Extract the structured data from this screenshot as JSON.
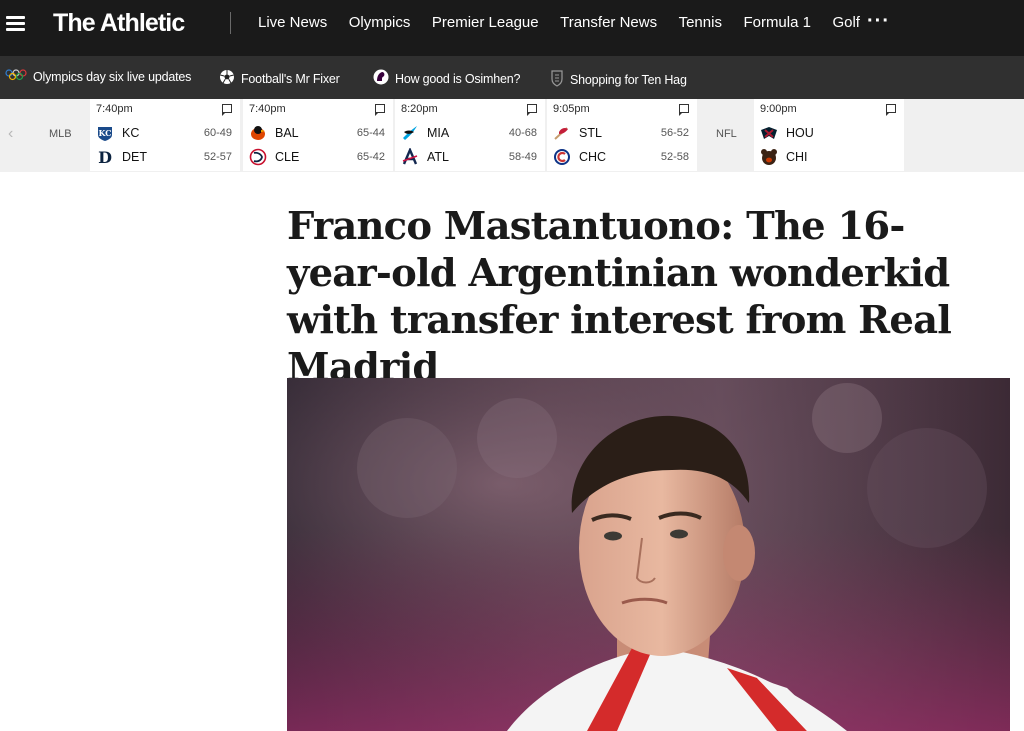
{
  "nav": {
    "logo": "The Athletic",
    "links": [
      "Live News",
      "Olympics",
      "Premier League",
      "Transfer News",
      "Tennis",
      "Formula 1",
      "Golf"
    ],
    "more": "···"
  },
  "trending": [
    {
      "label": "Olympics day six live updates",
      "icon": "olympic-rings-icon"
    },
    {
      "label": "Football's Mr Fixer",
      "icon": "soccer-ball-icon"
    },
    {
      "label": "How good is Osimhen?",
      "icon": "premier-league-icon"
    },
    {
      "label": "Shopping for Ten Hag",
      "icon": "club-crest-icon"
    }
  ],
  "scores": {
    "leagues": [
      "MLB",
      "NFL"
    ],
    "games": [
      {
        "time": "7:40pm",
        "teams": [
          {
            "abbr": "KC",
            "record": "60-49"
          },
          {
            "abbr": "DET",
            "record": "52-57"
          }
        ]
      },
      {
        "time": "7:40pm",
        "teams": [
          {
            "abbr": "BAL",
            "record": "65-44"
          },
          {
            "abbr": "CLE",
            "record": "65-42"
          }
        ]
      },
      {
        "time": "8:20pm",
        "teams": [
          {
            "abbr": "MIA",
            "record": "40-68"
          },
          {
            "abbr": "ATL",
            "record": "58-49"
          }
        ]
      },
      {
        "time": "9:05pm",
        "teams": [
          {
            "abbr": "STL",
            "record": "56-52"
          },
          {
            "abbr": "CHC",
            "record": "52-58"
          }
        ]
      },
      {
        "time": "9:00pm",
        "teams": [
          {
            "abbr": "HOU",
            "record": ""
          },
          {
            "abbr": "CHI",
            "record": ""
          }
        ]
      }
    ]
  },
  "article": {
    "headline": "Franco Mastantuono: The 16-year-old Argentinian wonderkid with transfer interest from Real Madrid"
  },
  "colors": {
    "nav_bg": "#1a1a1a",
    "trending_bg": "#303030",
    "scores_bg": "#f0f0f0",
    "kit_red": "#d42b2b"
  }
}
